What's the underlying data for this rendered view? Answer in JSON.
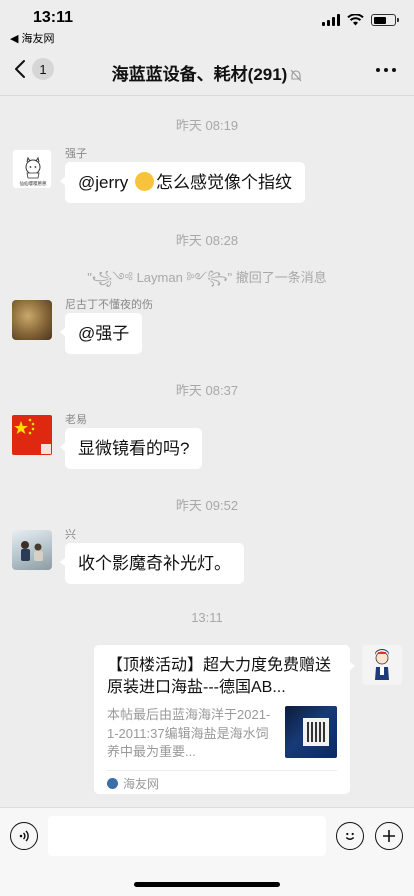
{
  "status_bar": {
    "time": "13:11",
    "back_app": "◀ 海友网",
    "battery_level": 0.6
  },
  "nav": {
    "unread_count": "1",
    "title": "海蓝蓝设备、耗材(291)"
  },
  "chat": {
    "items": [
      {
        "kind": "timestamp",
        "text": "昨天 08:19"
      },
      {
        "kind": "message",
        "sender": "强子",
        "text_before": "@jerry ",
        "text_after": "怎么感觉像个指纹",
        "avatar_text": "仙仙嘤嘤蒽蒽"
      },
      {
        "kind": "timestamp",
        "text": "昨天 08:28"
      },
      {
        "kind": "system",
        "text": "\"꧁༺ Layman ༻꧂\" 撤回了一条消息"
      },
      {
        "kind": "message",
        "sender": "尼古丁不懂夜的伤",
        "text": "@强子"
      },
      {
        "kind": "timestamp",
        "text": "昨天 08:37"
      },
      {
        "kind": "message",
        "sender": "老易",
        "text": "显微镜看的吗?"
      },
      {
        "kind": "timestamp",
        "text": "昨天 09:52"
      },
      {
        "kind": "message",
        "sender": "兴",
        "text": "收个影魔奇补光灯。"
      },
      {
        "kind": "timestamp",
        "text": "13:11"
      }
    ]
  },
  "link_card": {
    "title": "【顶楼活动】超大力度免费赠送原装进口海盐---德国AB...",
    "description": "本帖最后由蓝海海洋于2021-1-2011:37编辑海盐是海水饲养中最为重要...",
    "source": "海友网"
  },
  "input_bar": {
    "placeholder": ""
  },
  "colors": {
    "background": "#ededed",
    "bubble": "#ffffff",
    "timestamp": "#a8a8a8"
  }
}
